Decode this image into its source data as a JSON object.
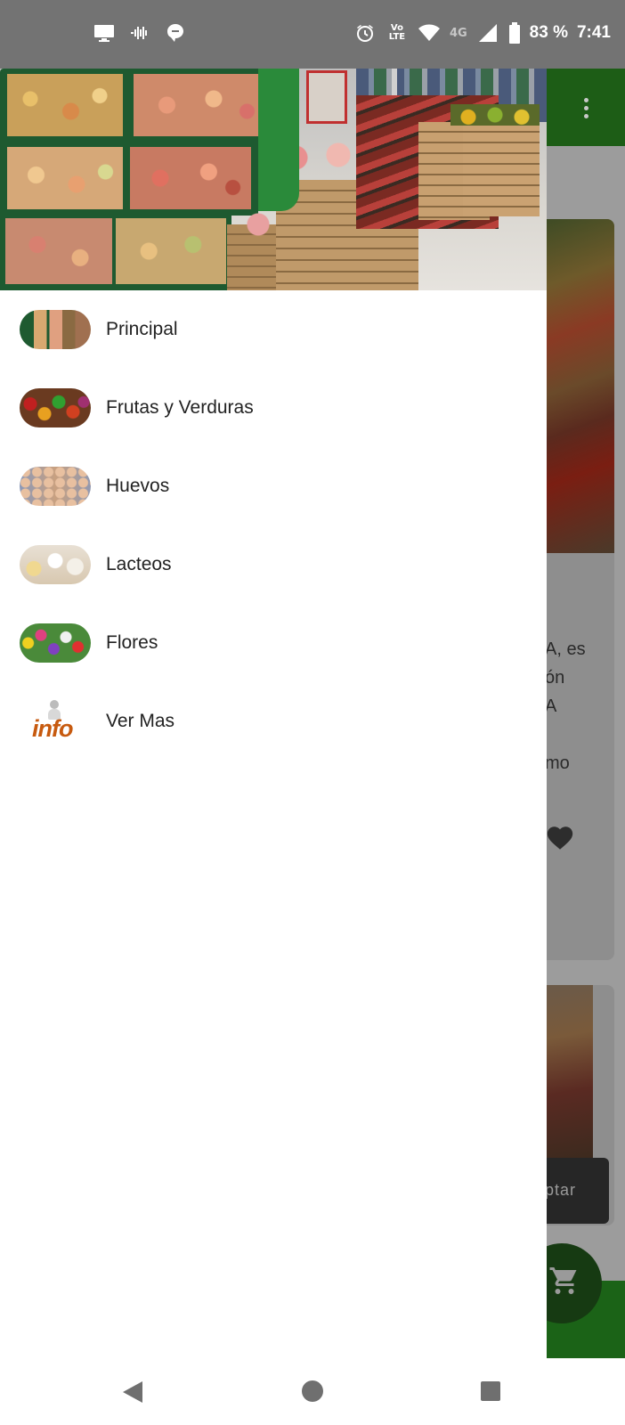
{
  "status_bar": {
    "battery": "83 %",
    "time": "7:41",
    "network_lte_top": "Vo",
    "network_lte_bottom": "LTE",
    "network_4g": "4G",
    "icons_left": [
      "screen-cast-icon",
      "audio-wave-icon",
      "messaging-icon"
    ],
    "icons_right": [
      "alarm-icon",
      "volte-icon",
      "wifi-icon",
      "signal-icon",
      "battery-icon"
    ]
  },
  "drawer": {
    "header_image": "supermarket-produce-aisle",
    "items": [
      {
        "label": "Principal",
        "thumbnail": "supermarket-thumb"
      },
      {
        "label": "Frutas y Verduras",
        "thumbnail": "fruits-vegetables-thumb"
      },
      {
        "label": "Huevos",
        "thumbnail": "eggs-thumb"
      },
      {
        "label": "Lacteos",
        "thumbnail": "dairy-thumb"
      },
      {
        "label": "Flores",
        "thumbnail": "flowers-thumb"
      },
      {
        "label": "Ver Mas",
        "thumbnail": "info-thumb",
        "thumbnail_text": "info"
      }
    ]
  },
  "background_app": {
    "card_text_lines": [
      "A, es",
      "ón",
      "A",
      "mo"
    ],
    "toast_text": "ptar",
    "colors": {
      "toolbar": "#1d5d16",
      "accent": "#1b6317"
    }
  },
  "nav_bar": {
    "buttons": [
      "back",
      "home",
      "recents"
    ]
  }
}
